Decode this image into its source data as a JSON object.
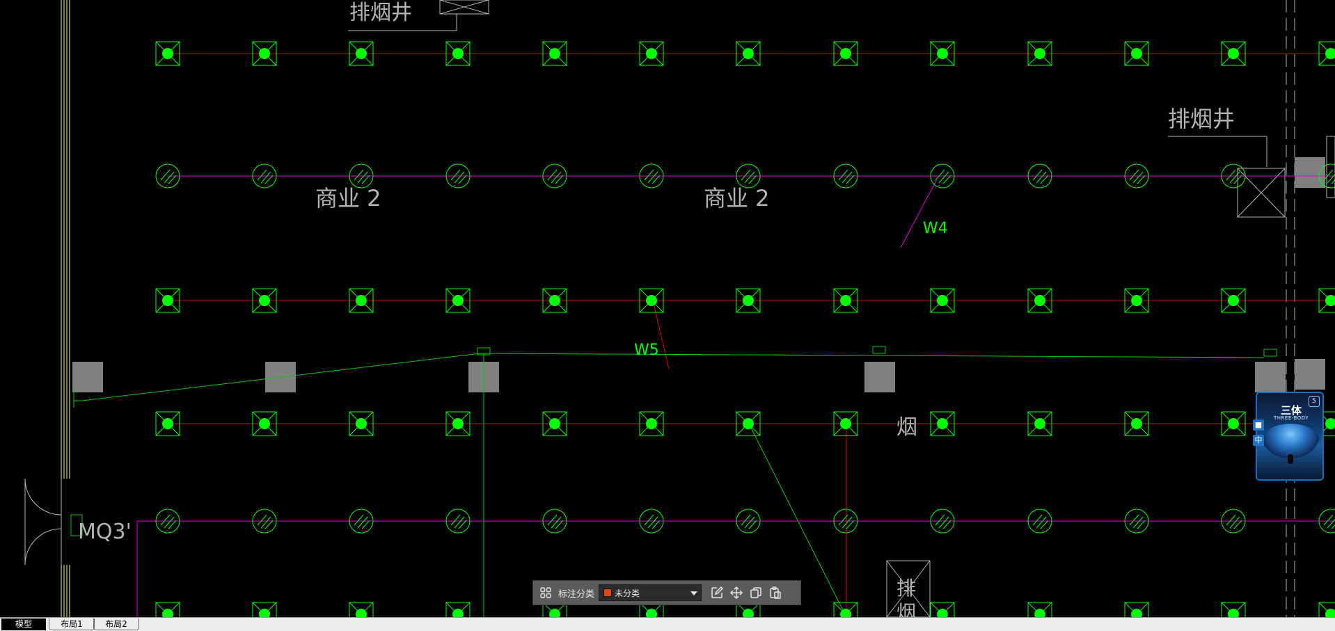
{
  "drawing": {
    "labels": {
      "smoke_shaft_1": "排烟井",
      "smoke_shaft_2": "排烟井",
      "commercial_1": "商业 2",
      "commercial_2": "商业 2",
      "w4": "W4",
      "w5": "W5",
      "smoke": "烟",
      "mq3": "MQ3'",
      "smoke_shaft_partial_1": "排",
      "smoke_shaft_partial_2": "烟"
    },
    "colors": {
      "sprinkler": "#00ff00",
      "pipe_red": "#e00000",
      "pipe_magenta": "#e000e0",
      "pipe_green": "#00cc00",
      "text_gray": "#b4b4b4",
      "column_gray": "#808080",
      "wall_yellow": "#ffff66"
    }
  },
  "toolbar": {
    "grid_icon": "grid-icon",
    "label": "标注分类",
    "dropdown_value": "未分类",
    "swatch_color": "#e04a10",
    "tools": [
      "edit-icon",
      "move-icon",
      "copy-icon",
      "paste-icon"
    ]
  },
  "widget": {
    "title": "三体",
    "subtitle": "THREE-BODY",
    "badge": "5",
    "side_top": "■",
    "side_bottom": "中"
  },
  "tabs": [
    {
      "label": "模型"
    },
    {
      "label": "布局1"
    },
    {
      "label": "布局2"
    }
  ]
}
